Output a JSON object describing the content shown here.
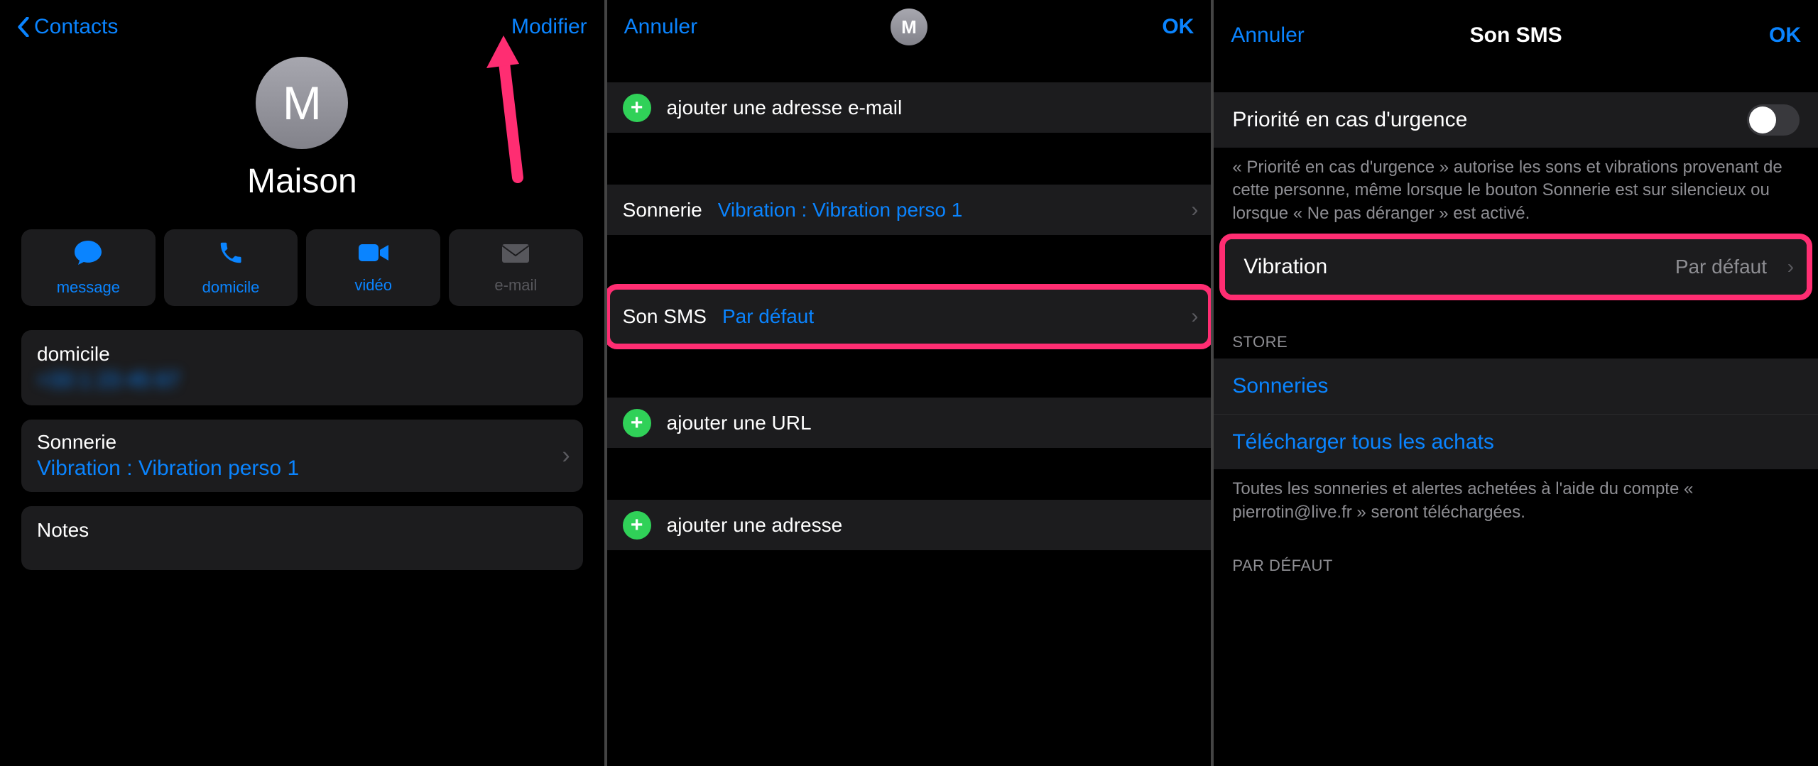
{
  "pane1": {
    "back_label": "Contacts",
    "edit_label": "Modifier",
    "avatar_letter": "M",
    "name": "Maison",
    "actions": {
      "message": "message",
      "domicile": "domicile",
      "video": "vidéo",
      "email": "e-mail"
    },
    "phone_card_label": "domicile",
    "phone_card_value_obfuscated": "+33 1 23 45 67",
    "ringtone_card_label": "Sonnerie",
    "ringtone_card_value": "Vibration : Vibration perso 1",
    "notes_card_label": "Notes"
  },
  "pane2": {
    "cancel": "Annuler",
    "ok": "OK",
    "avatar_letter": "M",
    "add_email": "ajouter une adresse e-mail",
    "ringtone_label": "Sonnerie",
    "ringtone_value": "Vibration : Vibration perso 1",
    "sms_label": "Son SMS",
    "sms_value": "Par défaut",
    "add_url": "ajouter une URL",
    "add_address": "ajouter une adresse"
  },
  "pane3": {
    "cancel": "Annuler",
    "title": "Son SMS",
    "ok": "OK",
    "priority_label": "Priorité en cas d'urgence",
    "priority_note": "« Priorité en cas d'urgence » autorise les sons et vibrations provenant de cette personne, même lorsque le bouton Sonnerie est sur silencieux ou lorsque « Ne pas déranger » est activé.",
    "vibration_label": "Vibration",
    "vibration_value": "Par défaut",
    "store_header": "STORE",
    "ringtones_link": "Sonneries",
    "download_link": "Télécharger tous les achats",
    "download_note": "Toutes les sonneries et alertes achetées à l'aide du compte « pierrotin@live.fr » seront téléchargées.",
    "default_header": "PAR DÉFAUT"
  },
  "colors": {
    "accent": "#0a84ff",
    "highlight": "#ff2d72",
    "green": "#30d158"
  }
}
